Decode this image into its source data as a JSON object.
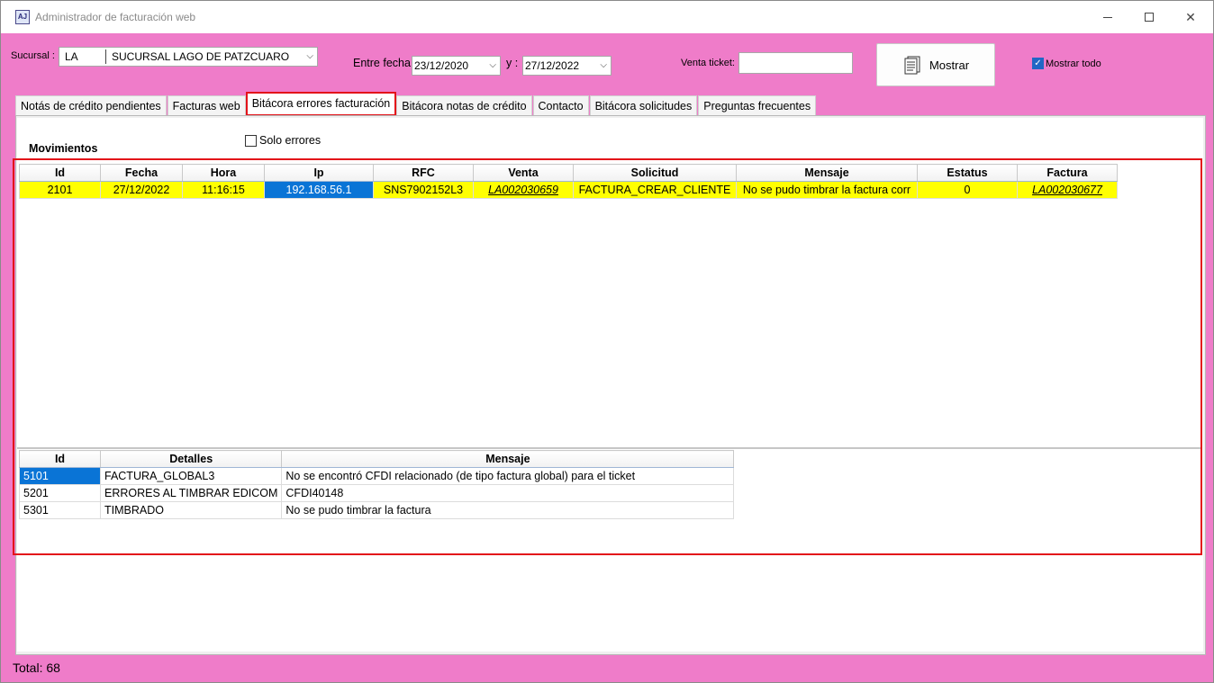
{
  "window": {
    "title": "Administrador de facturación web",
    "icon_text": "AJ"
  },
  "filters": {
    "sucursal_label": "Sucursal :",
    "sucursal_code": "LA",
    "sucursal_name": "SUCURSAL LAGO DE PATZCUARO",
    "entre_fecha_label": "Entre fecha",
    "fecha_inicio": "23/12/2020",
    "y_label": "y :",
    "fecha_fin": "27/12/2022",
    "venta_ticket_label": "Venta ticket:",
    "venta_ticket_value": "",
    "mostrar_button": "Mostrar",
    "mostrar_todo_label": "Mostrar todo",
    "mostrar_todo_checked": true
  },
  "tabs": [
    {
      "label": "Notás de crédito pendientes"
    },
    {
      "label": "Facturas web"
    },
    {
      "label": "Bitácora errores facturación",
      "active": true
    },
    {
      "label": "Bitácora notas de crédito"
    },
    {
      "label": "Contacto"
    },
    {
      "label": "Bitácora solicitudes"
    },
    {
      "label": "Preguntas frecuentes"
    }
  ],
  "movimientos": {
    "title": "Movimientos",
    "solo_errores_label": "Solo errores",
    "columns": [
      "Id",
      "Fecha",
      "Hora",
      "Ip",
      "RFC",
      "Venta",
      "Solicitud",
      "Mensaje",
      "Estatus",
      "Factura"
    ],
    "rows": [
      {
        "id": "2101",
        "fecha": "27/12/2022",
        "hora": "11:16:15",
        "ip": "192.168.56.1",
        "rfc": "SNS7902152L3",
        "venta": "LA002030659",
        "solicitud": "FACTURA_CREAR_CLIENTE",
        "mensaje": "No se pudo timbrar la factura corr",
        "estatus": "0",
        "factura": "LA002030677"
      }
    ]
  },
  "detalles": {
    "columns": [
      "Id",
      "Detalles",
      "Mensaje"
    ],
    "rows": [
      {
        "id": "5101",
        "detalle": "FACTURA_GLOBAL3",
        "mensaje": "No se encontró CFDI relacionado (de tipo factura global) para el ticket"
      },
      {
        "id": "5201",
        "detalle": "ERRORES AL TIMBRAR EDICOM",
        "mensaje": "CFDI40148"
      },
      {
        "id": "5301",
        "detalle": "TIMBRADO",
        "mensaje": "No se pudo timbrar la factura"
      }
    ]
  },
  "footer": {
    "total": "Total: 68"
  },
  "colors": {
    "window_bg": "#ef7cc9",
    "row_highlight": "#ffff00",
    "selection": "#0a74d6",
    "annotation": "#e3131a"
  }
}
